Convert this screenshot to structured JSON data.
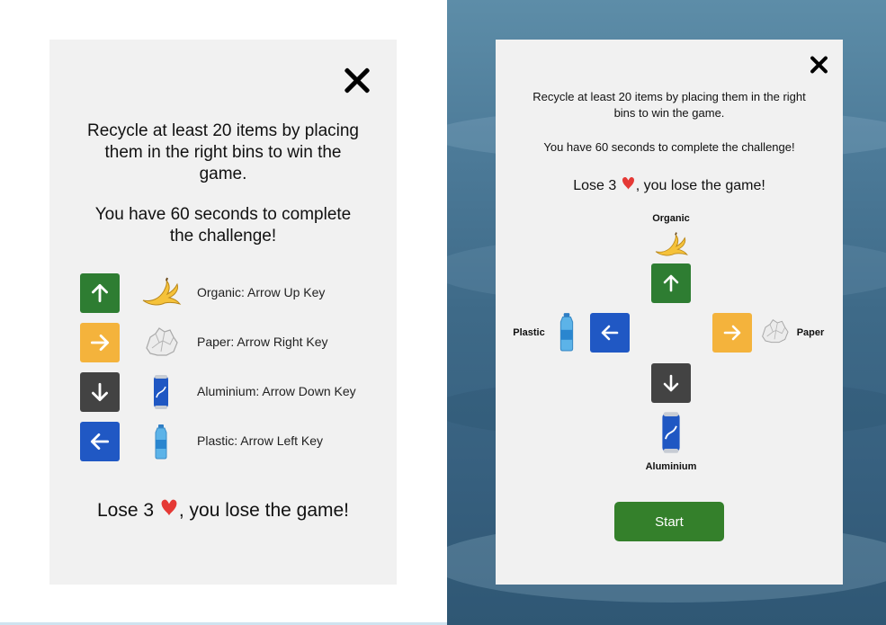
{
  "instructions": {
    "intro": "Recycle at least 20 items by placing them in the right bins to win the game.",
    "seconds": "You have 60 seconds to complete the challenge!",
    "lose_prefix": "Lose 3",
    "lose_suffix": ", you lose the game!"
  },
  "key_rows": [
    {
      "label": "Organic: Arrow Up Key",
      "color": "#2e7d32",
      "arrow": "up",
      "item_icon": "banana-peel-icon"
    },
    {
      "label": "Paper: Arrow Right Key",
      "color": "#f4b33c",
      "arrow": "right",
      "item_icon": "crumpled-paper-icon"
    },
    {
      "label": "Aluminium: Arrow Down Key",
      "color": "#434343",
      "arrow": "down",
      "item_icon": "soda-can-icon"
    },
    {
      "label": "Plastic: Arrow Left Key",
      "color": "#2058c4",
      "arrow": "left",
      "item_icon": "plastic-bottle-icon"
    }
  ],
  "bins": {
    "organic": "Organic",
    "plastic": "Plastic",
    "paper": "Paper",
    "aluminium": "Aluminium"
  },
  "start_button": "Start",
  "colors": {
    "organic": "#2e7d32",
    "paper": "#f4b33c",
    "aluminium": "#434343",
    "plastic": "#2058c4",
    "heart": "#e53935",
    "start": "#34802b"
  }
}
